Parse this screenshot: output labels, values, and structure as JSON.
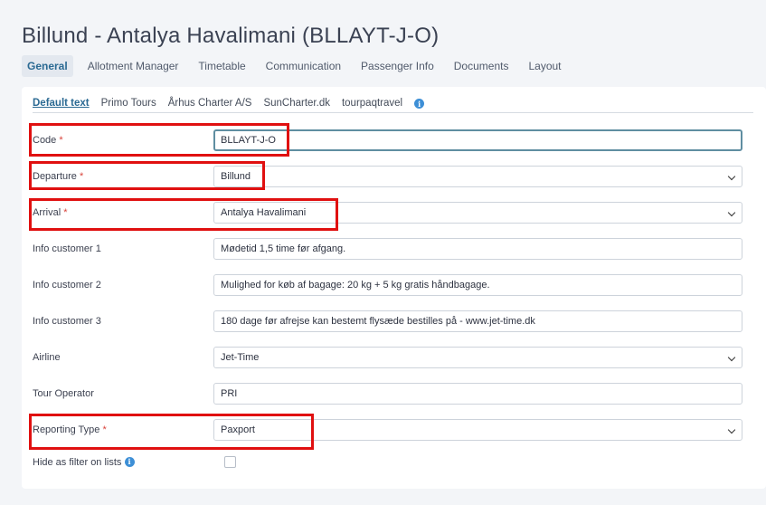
{
  "page": {
    "title": "Billund - Antalya Havalimani (BLLAYT-J-O)"
  },
  "main_tabs": [
    {
      "label": "General",
      "active": true
    },
    {
      "label": "Allotment Manager"
    },
    {
      "label": "Timetable"
    },
    {
      "label": "Communication"
    },
    {
      "label": "Passenger Info"
    },
    {
      "label": "Documents"
    },
    {
      "label": "Layout"
    }
  ],
  "sub_tabs": [
    {
      "label": "Default text",
      "active": true
    },
    {
      "label": "Primo Tours"
    },
    {
      "label": "Århus Charter A/S"
    },
    {
      "label": "SunCharter.dk"
    },
    {
      "label": "tourpaqtravel"
    }
  ],
  "info_icon": "i",
  "form": {
    "code": {
      "label": "Code",
      "required": "*",
      "value": "BLLAYT-J-O"
    },
    "departure": {
      "label": "Departure",
      "required": "*",
      "value": "Billund"
    },
    "arrival": {
      "label": "Arrival",
      "required": "*",
      "value": "Antalya Havalimani"
    },
    "info_customer_1": {
      "label": "Info customer 1",
      "value": "Mødetid 1,5 time før afgang."
    },
    "info_customer_2": {
      "label": "Info customer 2",
      "value": "Mulighed for køb af bagage: 20 kg + 5 kg gratis håndbagage."
    },
    "info_customer_3": {
      "label": "Info customer 3",
      "value": "180 dage før afrejse kan bestemt flysæde bestilles på - www.jet-time.dk"
    },
    "airline": {
      "label": "Airline",
      "value": "Jet-Time"
    },
    "tour_operator": {
      "label": "Tour Operator",
      "value": "PRI"
    },
    "reporting_type": {
      "label": "Reporting Type",
      "required": "*",
      "value": "Paxport"
    },
    "hide_as_filter": {
      "label": "Hide as filter on lists",
      "checked": false
    }
  },
  "colors": {
    "accent": "#2b6a93",
    "required": "#d9433b",
    "highlight": "#e01010",
    "info_icon": "#3d8fd6"
  }
}
